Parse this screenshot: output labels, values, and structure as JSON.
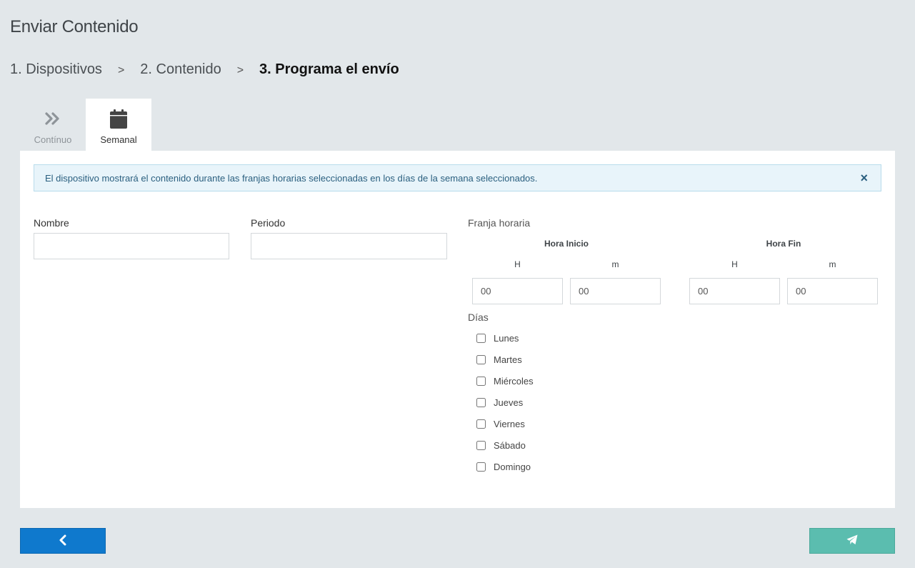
{
  "page": {
    "title": "Enviar Contenido"
  },
  "breadcrumb": {
    "steps": [
      "1. Dispositivos",
      "2. Contenido",
      "3. Programa el envío"
    ],
    "separator": ">"
  },
  "tabs": [
    {
      "label": "Contínuo",
      "icon": "double-chevron-right-icon",
      "active": false
    },
    {
      "label": "Semanal",
      "icon": "calendar-icon",
      "active": true
    }
  ],
  "alert": {
    "message": "El dispositivo mostrará el contenido durante las franjas horarias seleccionadas en los días de la semana seleccionados.",
    "close": "×"
  },
  "form": {
    "nombre_label": "Nombre",
    "nombre_value": "",
    "periodo_label": "Periodo",
    "periodo_value": "",
    "franja_label": "Franja horaria",
    "hora_inicio_label": "Hora Inicio",
    "hora_fin_label": "Hora Fin",
    "h_label": "H",
    "m_label": "m",
    "inicio_h": "00",
    "inicio_m": "00",
    "fin_h": "00",
    "fin_m": "00",
    "dias_label": "Días",
    "days": [
      "Lunes",
      "Martes",
      "Miércoles",
      "Jueves",
      "Viernes",
      "Sábado",
      "Domingo"
    ]
  },
  "colors": {
    "back_button": "#0f79cd",
    "send_button": "#5bbdaf",
    "alert_bg": "#e8f4fa"
  },
  "buttons": {
    "back_icon": "chevron-left-icon",
    "send_icon": "paper-plane-icon"
  }
}
